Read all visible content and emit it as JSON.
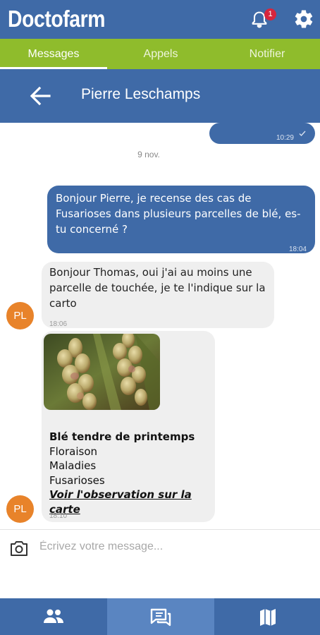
{
  "app": {
    "brand": "Doctofarm",
    "notification_count": "1"
  },
  "tabs": [
    {
      "label": "Messages",
      "active": true
    },
    {
      "label": "Appels",
      "active": false
    },
    {
      "label": "Notifier",
      "active": false
    }
  ],
  "chat": {
    "contact_name": "Pierre Leschamps",
    "contact_initials": "PL"
  },
  "messages": [
    {
      "direction": "out",
      "time": "10:29",
      "read": true
    },
    {
      "date_separator": "9 nov."
    },
    {
      "direction": "out",
      "text": "Bonjour Pierre, je recense des cas de Fusarioses dans plusieurs parcelles de blé, es-tu concerné ?",
      "time": "18:04"
    },
    {
      "direction": "in",
      "text": "Bonjour Thomas, oui j'ai au moins une parcelle de touchée, je te l'indique sur la carto",
      "time": "18:06"
    },
    {
      "direction": "in",
      "observation": {
        "crop": "Blé tendre de printemps",
        "stage": "Floraison",
        "category": "Maladies",
        "disease": "Fusarioses",
        "link": "Voir l'observation sur la carte"
      },
      "time": "18:10"
    }
  ],
  "composer": {
    "placeholder": "Écrivez votre message..."
  },
  "icons": {
    "notification": "bell-icon",
    "settings": "gear-icon",
    "back": "arrow-left-icon",
    "camera": "camera-icon",
    "contacts": "people-icon",
    "messages": "chat-icon",
    "map": "map-icon",
    "read_receipt": "check-icon"
  },
  "colors": {
    "primary": "#3f6aa7",
    "accent_green": "#8fbc2c",
    "avatar": "#e8832a",
    "badge": "#d7263d"
  }
}
